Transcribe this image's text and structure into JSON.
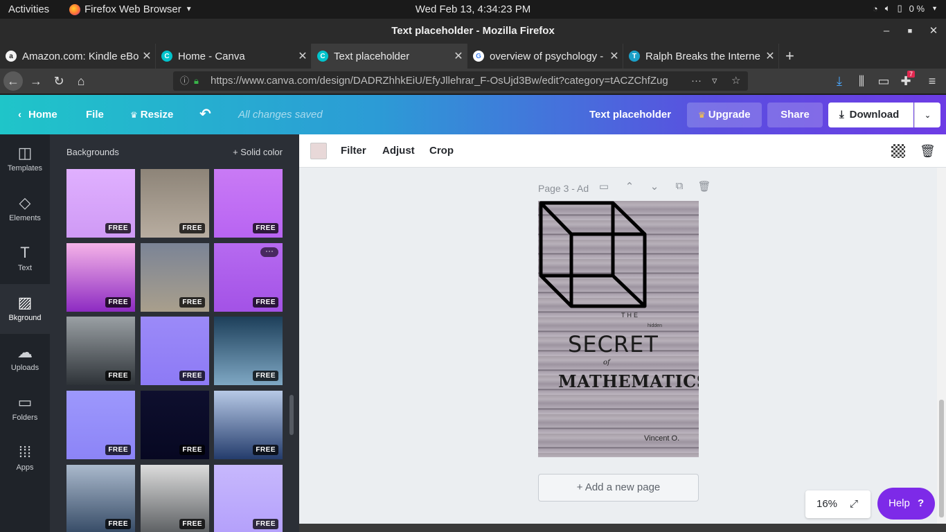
{
  "system": {
    "activities": "Activities",
    "app_menu": "Firefox Web Browser",
    "clock": "Wed Feb 13,  4:34:23 PM",
    "battery": "0 %"
  },
  "window": {
    "title": "Text placeholder - Mozilla Firefox"
  },
  "tabs": [
    {
      "label": "Amazon.com: Kindle eBo",
      "favicon": "amazon-icon",
      "color": "#f3f3f3"
    },
    {
      "label": "Home - Canva",
      "favicon": "canva-icon",
      "color": "#00c4cc"
    },
    {
      "label": "Text placeholder",
      "favicon": "canva-icon",
      "color": "#00c4cc"
    },
    {
      "label": "overview of psychology -",
      "favicon": "google-icon",
      "color": "#4285f4"
    },
    {
      "label": "Ralph Breaks the Interne",
      "favicon": "t-icon",
      "color": "#1ba0c8"
    }
  ],
  "navbar": {
    "url": "https://www.canva.com/design/DADRZhhkEiU/EfyJllehrar_F-OsUjd3Bw/edit?category=tACZChfZug",
    "notification_count": "7"
  },
  "canva_header": {
    "home": "Home",
    "file": "File",
    "resize": "Resize",
    "saved_status": "All changes saved",
    "design_title": "Text placeholder",
    "upgrade": "Upgrade",
    "share": "Share",
    "download": "Download"
  },
  "rail": [
    {
      "label": "Templates",
      "icon": "templates-icon"
    },
    {
      "label": "Elements",
      "icon": "elements-icon"
    },
    {
      "label": "Text",
      "icon": "text-icon"
    },
    {
      "label": "Bkground",
      "icon": "background-icon"
    },
    {
      "label": "Uploads",
      "icon": "uploads-icon"
    },
    {
      "label": "Folders",
      "icon": "folders-icon"
    },
    {
      "label": "Apps",
      "icon": "apps-icon"
    }
  ],
  "panel": {
    "title": "Backgrounds",
    "solid_color": "+ Solid color",
    "badge": "FREE",
    "backgrounds": [
      {
        "colors": [
          "#e0b0ff",
          "#cf9af5"
        ],
        "badge": "FREE"
      },
      {
        "colors": [
          "#8d8478",
          "#b8ada0"
        ],
        "badge": "FREE"
      },
      {
        "colors": [
          "#c97af5",
          "#b864f2"
        ],
        "badge": "FREE"
      },
      {
        "colors": [
          "#f5b3e8",
          "#8d2bc2"
        ],
        "badge": "FREE"
      },
      {
        "colors": [
          "#7b8496",
          "#a99f8c"
        ],
        "badge": "FREE"
      },
      {
        "colors": [
          "#b66af0",
          "#a352e6"
        ],
        "badge": "FREE"
      },
      {
        "colors": [
          "#9aa0a4",
          "#2e3338"
        ],
        "badge": "FREE"
      },
      {
        "colors": [
          "#9b8af8",
          "#8d7af5"
        ],
        "badge": "FREE"
      },
      {
        "colors": [
          "#1d3f5a",
          "#7fa8c4"
        ],
        "badge": "FREE"
      },
      {
        "colors": [
          "#9d98fc",
          "#8c84f7"
        ],
        "badge": "FREE"
      },
      {
        "colors": [
          "#0e0f2e",
          "#070822"
        ],
        "badge": "FREE"
      },
      {
        "colors": [
          "#b7c9e6",
          "#243c6c"
        ],
        "badge": "FREE"
      },
      {
        "colors": [
          "#aab9cc",
          "#364b66"
        ],
        "badge": "FREE"
      },
      {
        "colors": [
          "#dcdcdc",
          "#5c5f62"
        ],
        "badge": "FREE"
      },
      {
        "colors": [
          "#c7b8fd",
          "#b4a0fb"
        ],
        "badge": "FREE"
      }
    ]
  },
  "toolbar": {
    "swatch_color": "#e8d8d8",
    "filter": "Filter",
    "adjust": "Adjust",
    "crop": "Crop"
  },
  "canvas": {
    "page_label": "Page 3 - Ad",
    "add_page": "+ Add a new page",
    "zoom": "16%",
    "help": "Help",
    "design": {
      "the": "THE",
      "hidden": "hidden",
      "secret": "SECRET",
      "of": "of",
      "mathematics": "MATHEMATICS",
      "author": "Vincent O."
    }
  }
}
